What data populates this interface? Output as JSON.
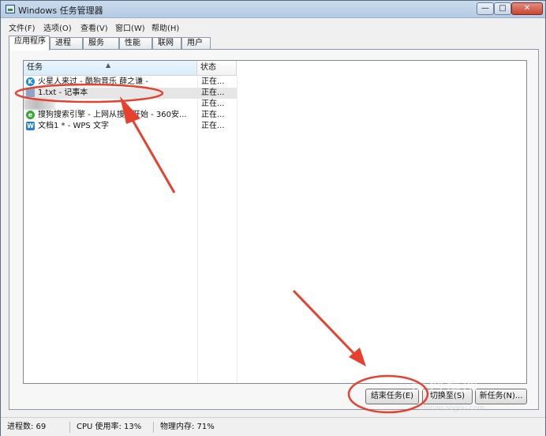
{
  "window": {
    "title": "Windows 任务管理器",
    "controls": {
      "minimize": "—",
      "maximize": "□",
      "close": "✕"
    }
  },
  "menu": [
    "文件(F)",
    "选项(O)",
    "查看(V)",
    "窗口(W)",
    "帮助(H)"
  ],
  "tabs": [
    "应用程序",
    "进程",
    "服务",
    "性能",
    "联网",
    "用户"
  ],
  "active_tab": "应用程序",
  "columns": {
    "task": "任务",
    "status": "状态"
  },
  "rows": [
    {
      "name": "火星人来过 - 酷狗音乐 薛之谦 -",
      "status": "正在...",
      "icon": "kugou-icon",
      "icon_color": "#1d8bd6",
      "icon_glyph": "K"
    },
    {
      "name": "1.txt - 记事本",
      "status": "正在...",
      "icon": "notepad-icon",
      "icon_color": "#8aa6c4",
      "icon_glyph": ""
    },
    {
      "name": "",
      "status": "正在...",
      "icon": "blurred-icon",
      "icon_color": "#c8c8c8",
      "icon_glyph": ""
    },
    {
      "name": "搜狗搜索引擎 - 上网从搜狗开始 - 360安...",
      "status": "正在...",
      "icon": "360-browser-icon",
      "icon_color": "#3aa63a",
      "icon_glyph": "e"
    },
    {
      "name": "文档1 * - WPS 文字",
      "status": "正在...",
      "icon": "wps-writer-icon",
      "icon_color": "#2a7fd0",
      "icon_glyph": "W"
    }
  ],
  "buttons": {
    "end_task": "结束任务(E)",
    "switch_to": "切换至(S)",
    "new_task": "新任务(N)..."
  },
  "statusbar": {
    "processes": "进程数: 69",
    "cpu": "CPU 使用率: 13%",
    "memory": "物理内存: 71%"
  },
  "annotation_colors": {
    "highlight": "#e8402e"
  },
  "watermark": {
    "text": "搜狗指南",
    "url": "zhinan.sogou.com"
  }
}
